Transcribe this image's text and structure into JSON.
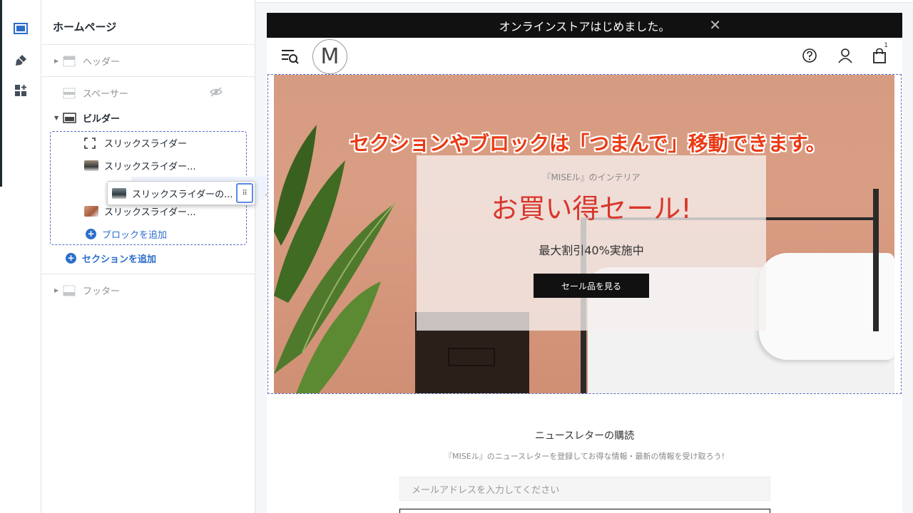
{
  "rail": {
    "icons": [
      "sections-icon",
      "theme-settings-icon",
      "apps-icon"
    ]
  },
  "sidebar": {
    "title": "ホームページ",
    "header_label": "ヘッダー",
    "spacer_label": "スペーサー",
    "builder_label": "ビルダー",
    "blocks": [
      "スリックスライダー",
      "スリックスライダー...",
      "スリックスライダー..."
    ],
    "dragging_label": "スリックスライダーの...",
    "add_block_label": "ブロックを追加",
    "add_section_label": "セクションを追加",
    "footer_label": "フッター"
  },
  "preview": {
    "announcement": "オンラインストアはじめました。",
    "logo_letter": "M",
    "cart_count": "1",
    "hero": {
      "subtitle": "『MISEル』のインテリア",
      "title": "お買い得セール!",
      "description": "最大割引40%実施中",
      "button_label": "セール品を見る"
    },
    "annotation": "セクションやブロックは「つまんで」移動できます。",
    "newsletter": {
      "title": "ニュースレターの購読",
      "description": "『MISEル』のニュースレターを登録してお得な情報・最新の情報を受け取ろう!",
      "email_placeholder": "メールアドレスを入力してください"
    }
  },
  "colors": {
    "accent_blue": "#2c6ecb",
    "sale_red": "#d9362b",
    "annotation_red": "#ea3a14"
  }
}
